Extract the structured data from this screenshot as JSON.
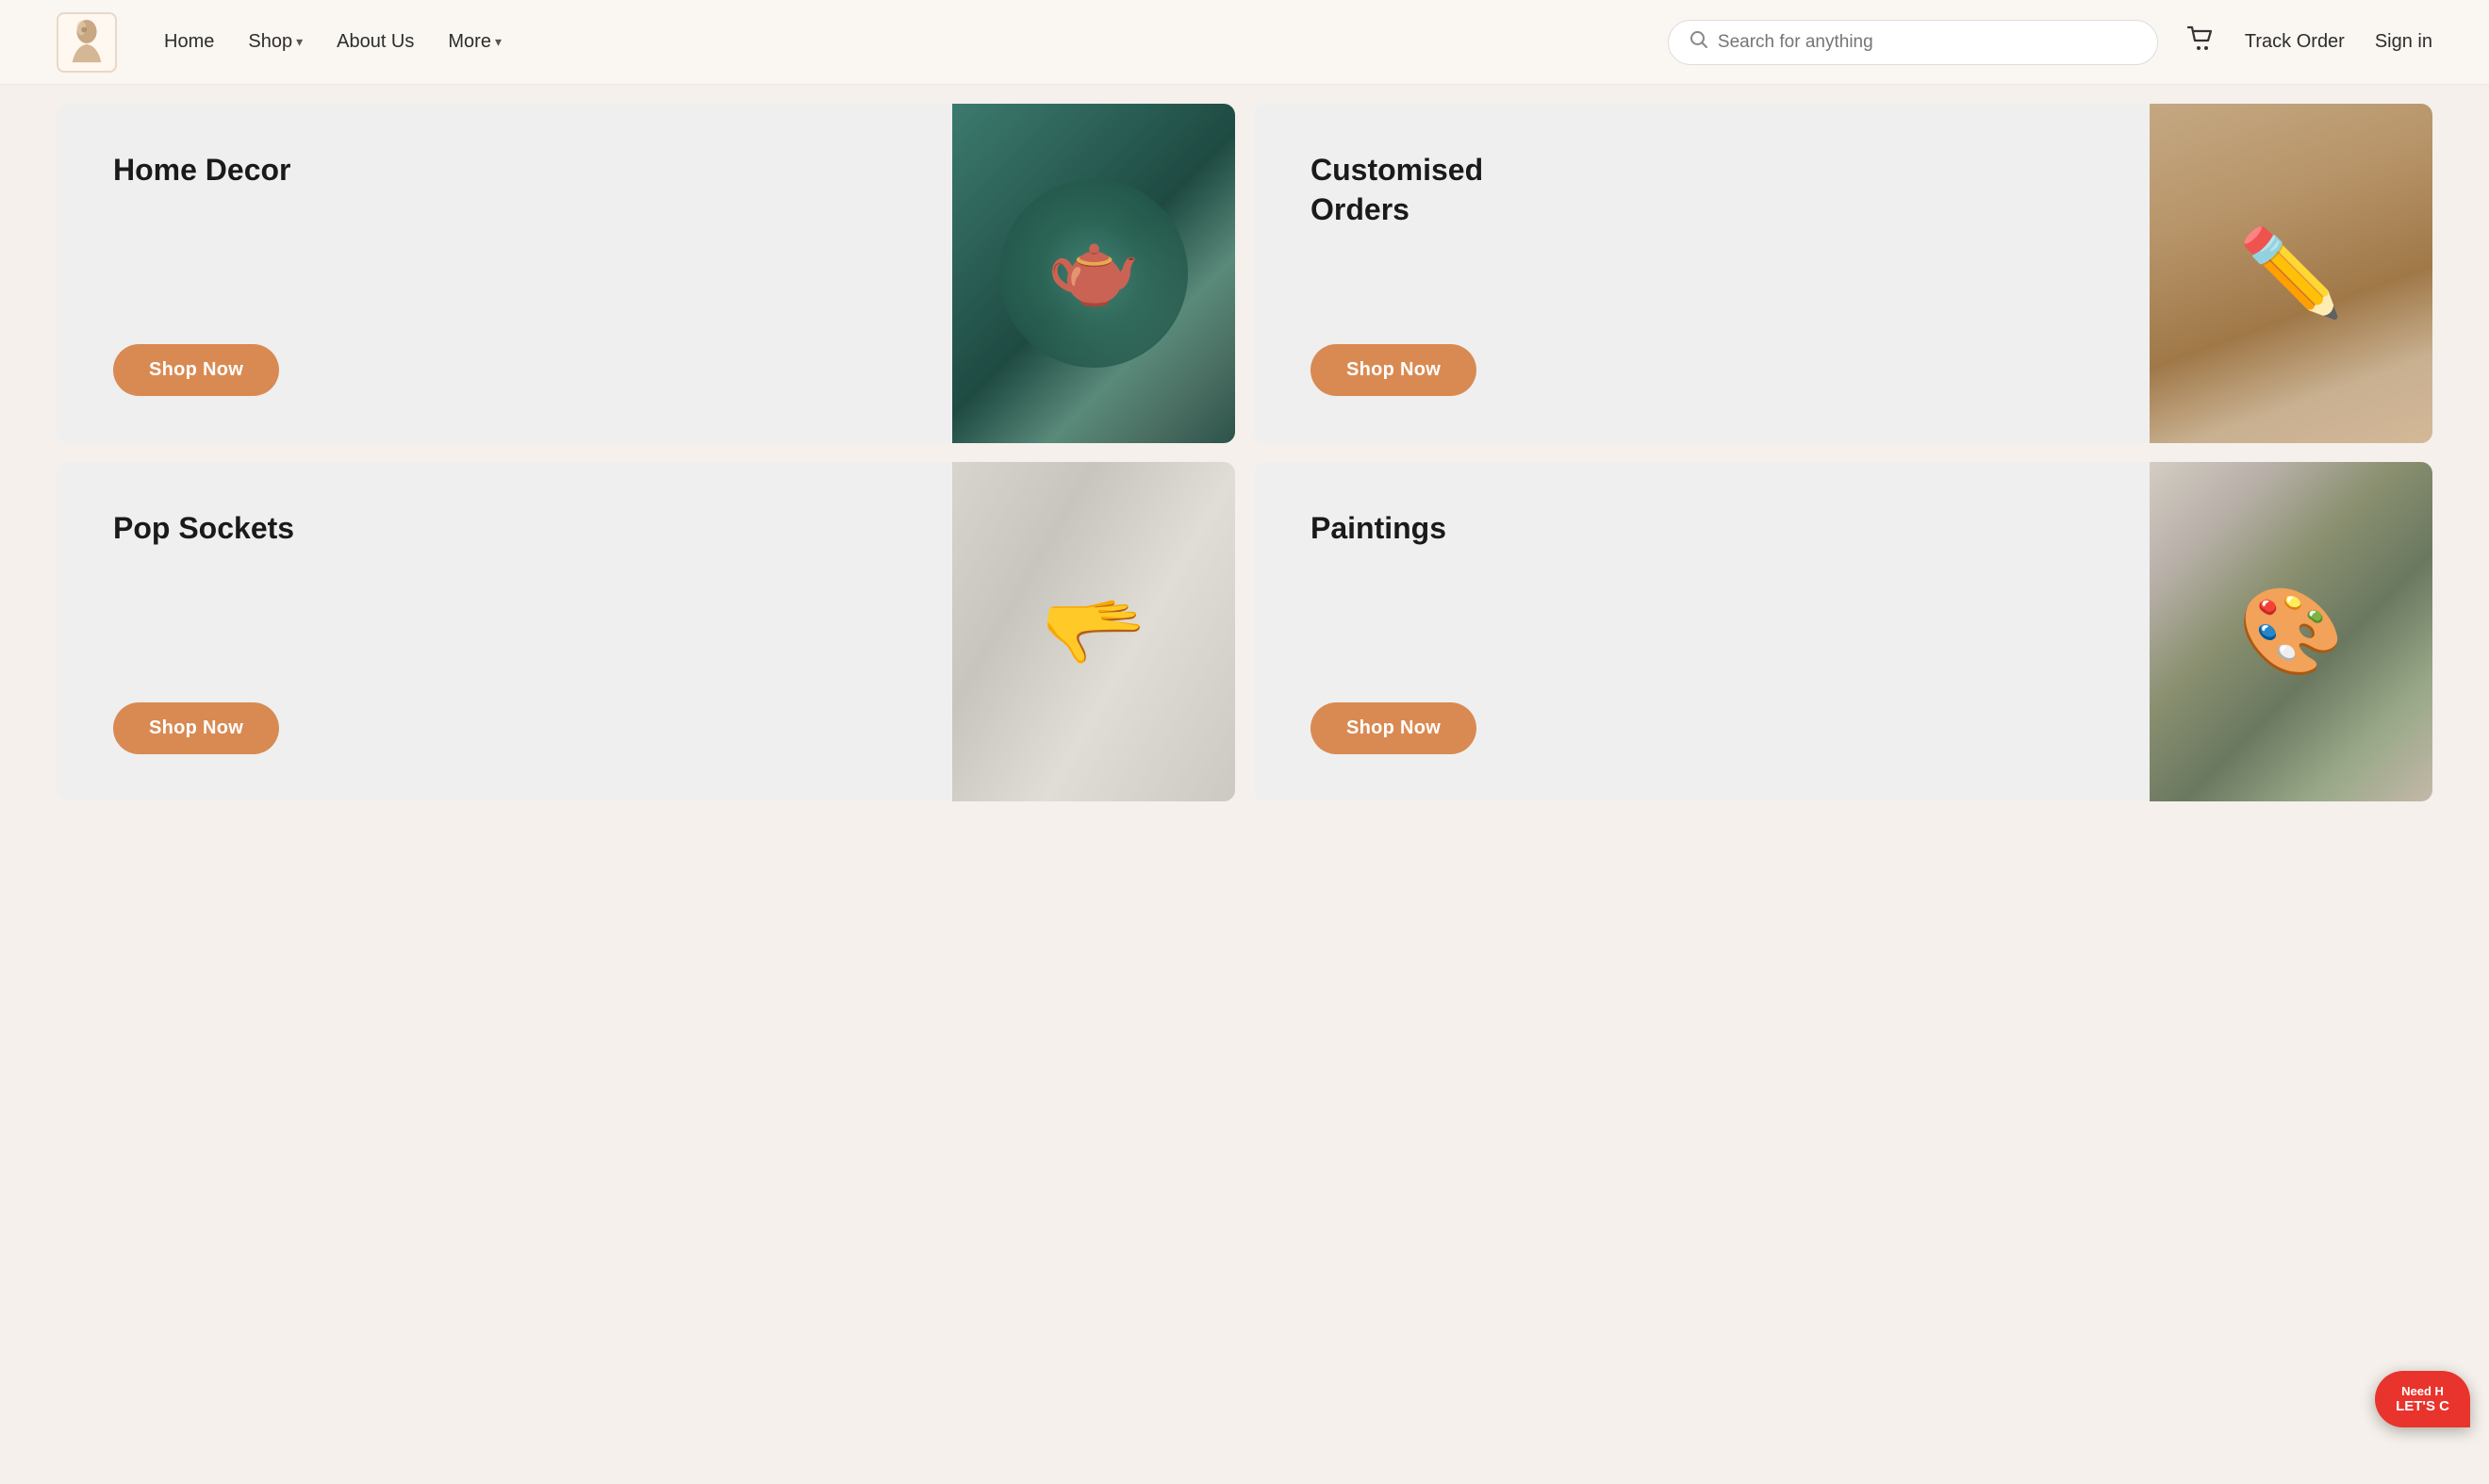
{
  "navbar": {
    "logo_alt": "Not Art Girl logo",
    "links": [
      {
        "label": "Home",
        "has_dropdown": false
      },
      {
        "label": "Shop",
        "has_dropdown": true
      },
      {
        "label": "About Us",
        "has_dropdown": false
      },
      {
        "label": "More",
        "has_dropdown": true
      }
    ],
    "search_placeholder": "Search for anything",
    "track_order_label": "Track Order",
    "sign_in_label": "Sign in"
  },
  "categories": [
    {
      "id": "home-decor",
      "title": "Home Decor",
      "button_label": "Shop Now",
      "image_class": "img-home-decor"
    },
    {
      "id": "customised-orders",
      "title": "Customised Orders",
      "button_label": "Shop Now",
      "image_class": "img-custom-orders"
    },
    {
      "id": "pop-sockets",
      "title": "Pop Sockets",
      "button_label": "Shop Now",
      "image_class": "img-pop-sockets"
    },
    {
      "id": "paintings",
      "title": "Paintings",
      "button_label": "Shop Now",
      "image_class": "img-paintings"
    }
  ],
  "chat_widget": {
    "top_text": "Need H",
    "bottom_text": "LET'S C"
  },
  "colors": {
    "button_bg": "#d98a52",
    "navbar_bg": "#faf6f1",
    "page_bg": "#f5f0eb"
  }
}
